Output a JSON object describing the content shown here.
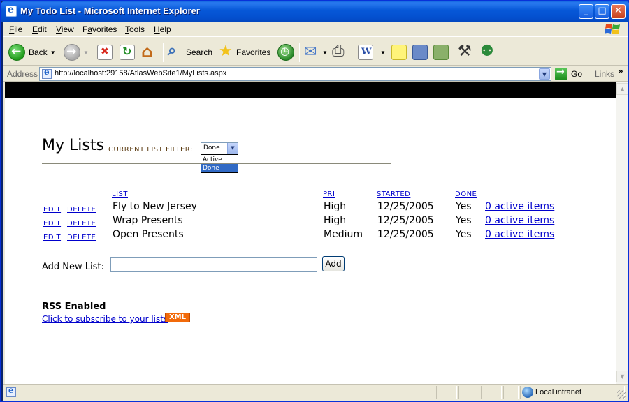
{
  "window": {
    "title": "My Todo List - Microsoft Internet Explorer",
    "minimize": "_",
    "maximize": "□",
    "close": "✕"
  },
  "menu": [
    {
      "ul": "F",
      "rest": "ile"
    },
    {
      "ul": "E",
      "rest": "dit"
    },
    {
      "ul": "V",
      "rest": "iew"
    },
    {
      "ul": "",
      "pre": "F",
      "ul2": "a",
      "rest": "vorites"
    },
    {
      "ul": "T",
      "rest": "ools"
    },
    {
      "ul": "H",
      "rest": "elp"
    }
  ],
  "toolbar": {
    "back": "Back",
    "search": "Search",
    "favorites": "Favorites"
  },
  "address": {
    "label": "Address",
    "url": "http://localhost:29158/AtlasWebSite1/MyLists.aspx",
    "go": "Go",
    "links": "Links"
  },
  "page": {
    "title": "My Lists",
    "filter_label": "CURRENT LIST FILTER:",
    "filter_value": "Done",
    "filter_options": [
      "Active",
      "Done"
    ],
    "columns": {
      "list": "LIST",
      "pri": "PRI",
      "started": "STARTED",
      "done": "DONE"
    },
    "edit_label": "EDIT",
    "delete_label": "DELETE",
    "rows": [
      {
        "name": "Fly to New Jersey",
        "pri": "High",
        "started": "12/25/2005",
        "done": "Yes",
        "active": "0 active items"
      },
      {
        "name": "Wrap Presents",
        "pri": "High",
        "started": "12/25/2005",
        "done": "Yes",
        "active": "0 active items"
      },
      {
        "name": "Open Presents",
        "pri": "Medium",
        "started": "12/25/2005",
        "done": "Yes",
        "active": "0 active items"
      }
    ],
    "add_label": "Add New List:",
    "add_value": "",
    "add_button": "Add",
    "rss_title": "RSS Enabled",
    "rss_link": "Click to subscribe to your lists",
    "xml_badge": "XML"
  },
  "status": {
    "zone": "Local intranet"
  },
  "colors": {
    "link": "#0000cc",
    "title_bar": "#0758d8",
    "xml_badge": "#f26a0a"
  }
}
